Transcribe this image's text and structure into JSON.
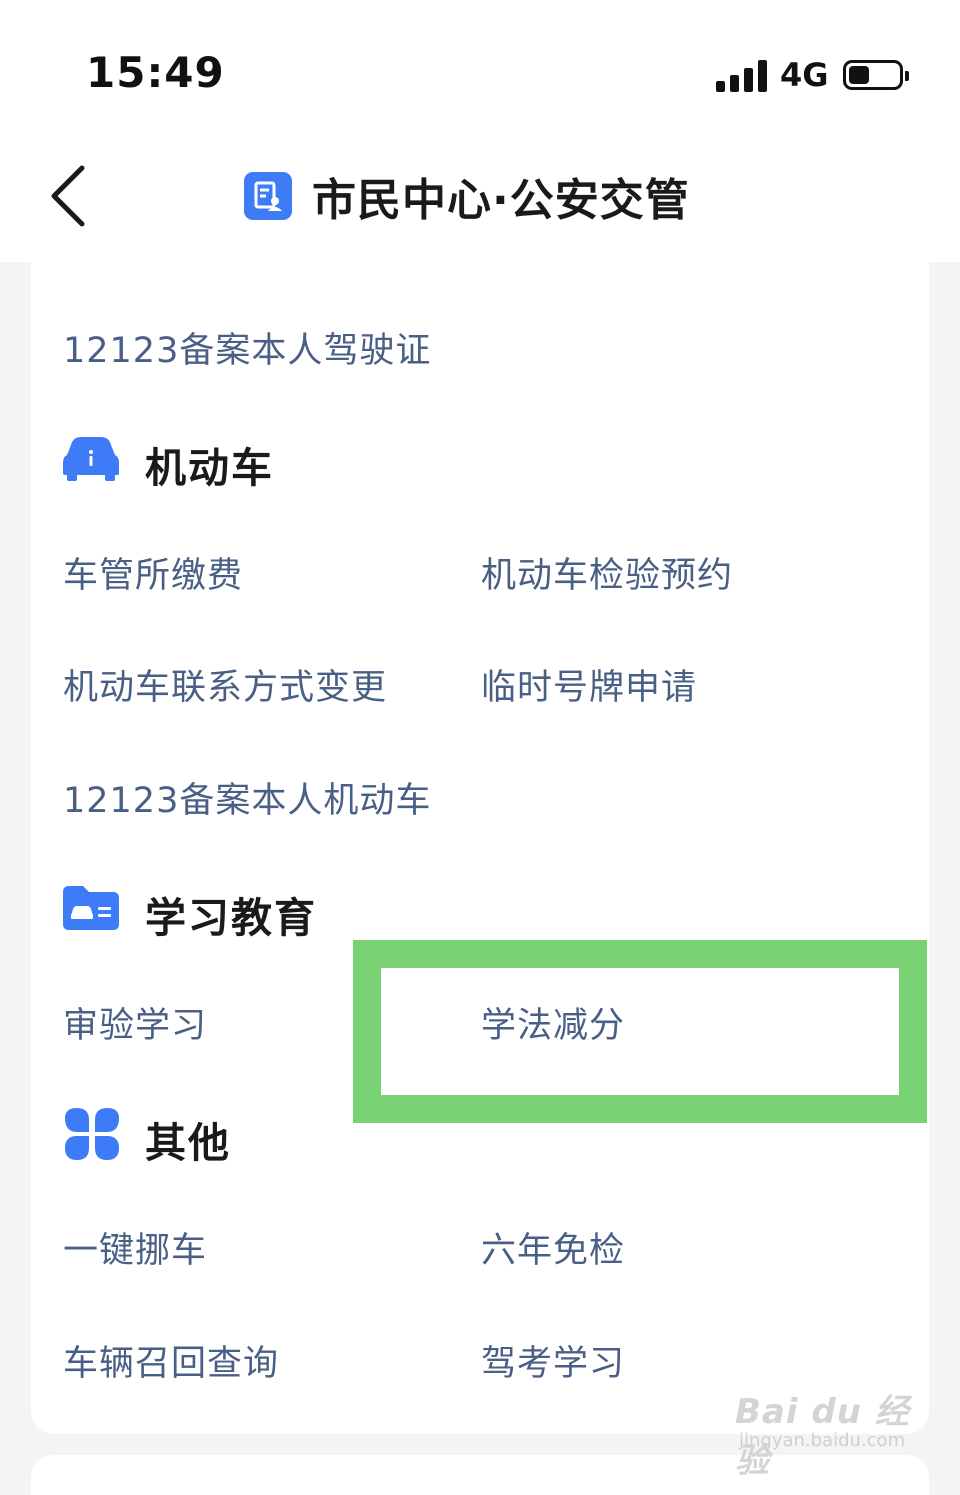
{
  "status_bar": {
    "time": "15:49",
    "network": "4G",
    "battery_level": 0.3
  },
  "header": {
    "title": "市民中心·公安交管",
    "back_icon": "chevron-left-icon",
    "title_icon": "document-user-icon"
  },
  "top_item": {
    "label": "12123备案本人驾驶证"
  },
  "sections": {
    "vehicle": {
      "title": "机动车",
      "icon": "car-info-icon",
      "items": [
        "车管所缴费",
        "机动车检验预约",
        "机动车联系方式变更",
        "临时号牌申请",
        "12123备案本人机动车"
      ]
    },
    "education": {
      "title": "学习教育",
      "icon": "folder-car-icon",
      "items": [
        "审验学习",
        "学法减分"
      ]
    },
    "other": {
      "title": "其他",
      "icon": "four-petal-icon",
      "items": [
        "一键挪车",
        "六年免检",
        "车辆召回查询",
        "驾考学习"
      ]
    }
  },
  "highlight_color": "#79d374",
  "accent_color": "#3d7cf6",
  "watermark": {
    "main": "Bai du 经验",
    "sub": "jingyan.baidu.com"
  }
}
